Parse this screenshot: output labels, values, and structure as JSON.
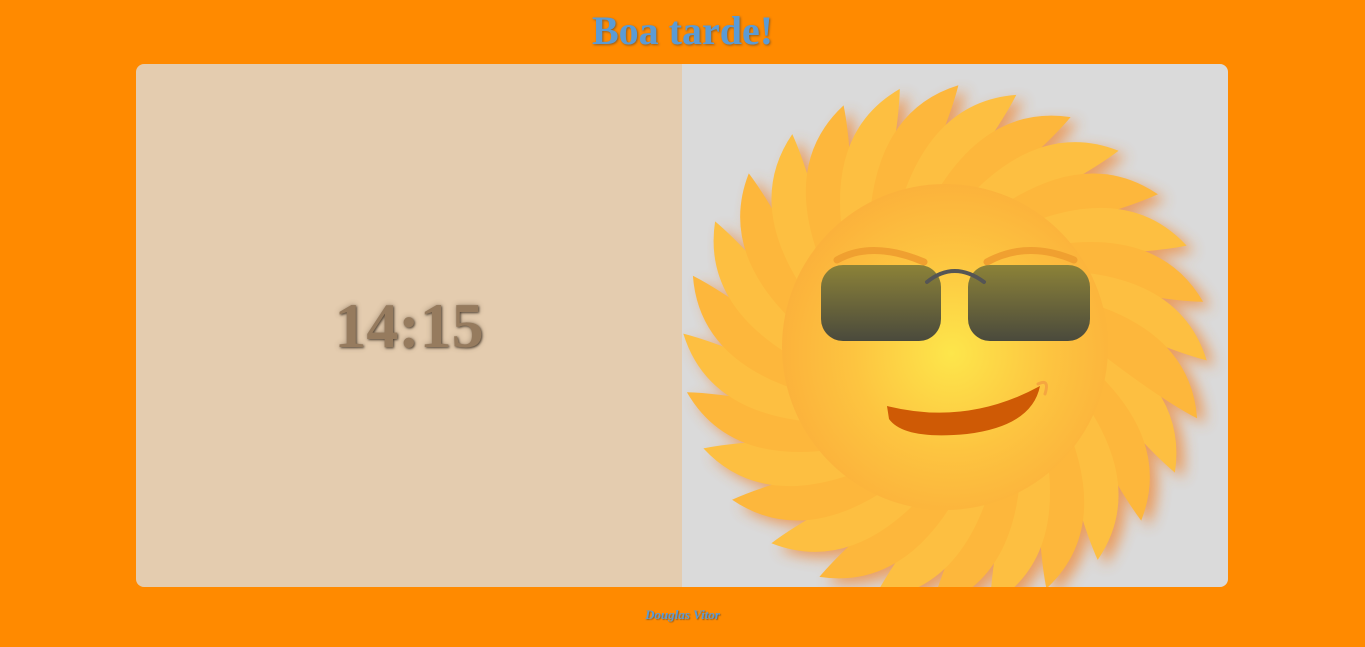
{
  "header": {
    "greeting": "Boa tarde!"
  },
  "clock": {
    "time": "14:15"
  },
  "illustration": {
    "subject": "sun-with-sunglasses"
  },
  "footer": {
    "author": "Douglas Vitor"
  },
  "colors": {
    "page_background": "#ff8a00",
    "title_text": "#5b9bd5",
    "clock_panel": "#e4ccaf",
    "clock_text": "#967b5e",
    "image_panel": "#dadada"
  }
}
